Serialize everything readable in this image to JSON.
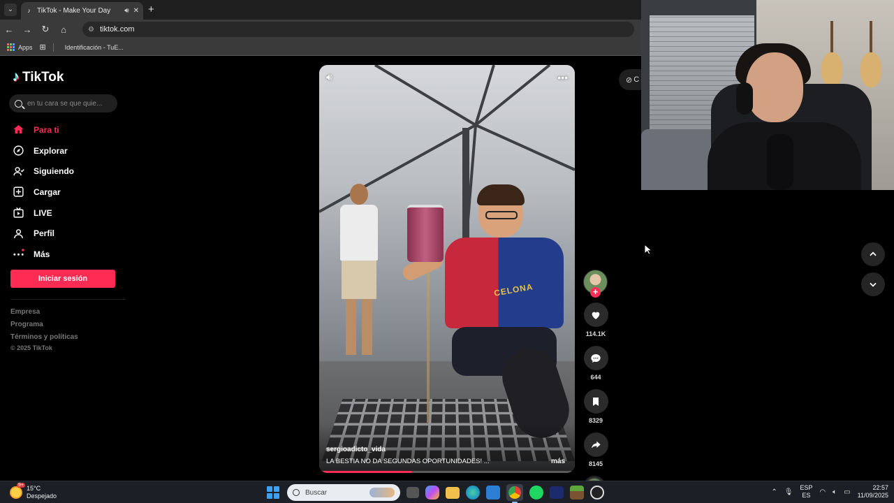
{
  "browser": {
    "tab_title": "TikTok - Make Your Day",
    "url": "tiktok.com",
    "bookmarks": [
      "Apps",
      "Identificación - TuE..."
    ]
  },
  "sidebar": {
    "logo": "TikTok",
    "search_placeholder": "en tu cara se que quie...",
    "nav": [
      {
        "label": "Para ti",
        "icon": "home-icon",
        "active": true
      },
      {
        "label": "Explorar",
        "icon": "compass-icon"
      },
      {
        "label": "Siguiendo",
        "icon": "following-icon"
      },
      {
        "label": "Cargar",
        "icon": "upload-icon"
      },
      {
        "label": "LIVE",
        "icon": "live-icon"
      },
      {
        "label": "Perfil",
        "icon": "profile-icon"
      },
      {
        "label": "Más",
        "icon": "more-icon"
      }
    ],
    "login_button": "Iniciar sesión",
    "footer": [
      "Empresa",
      "Programa",
      "Términos y políticas"
    ],
    "copyright": "© 2025 TikTok"
  },
  "video": {
    "author": "sergioadicto_vida",
    "caption": "LA BESTIA NO DA SEGUNDAS OPORTUNIDADES! ...",
    "more_label": "más",
    "shirt_text": "CELONA",
    "progress": 0.36
  },
  "actions": {
    "likes": "114.1K",
    "comments": "644",
    "saves": "8329",
    "shares": "8145"
  },
  "partial_button_text": "C",
  "taskbar": {
    "temperature": "15°C",
    "weather": "Despejado",
    "weather_badge": "9+",
    "search_placeholder": "Buscar",
    "lang_top": "ESP",
    "lang_bottom": "ES",
    "time": "22:57",
    "date": "11/09/2025"
  },
  "colors": {
    "accent": "#fe2c55",
    "background": "#000000"
  }
}
